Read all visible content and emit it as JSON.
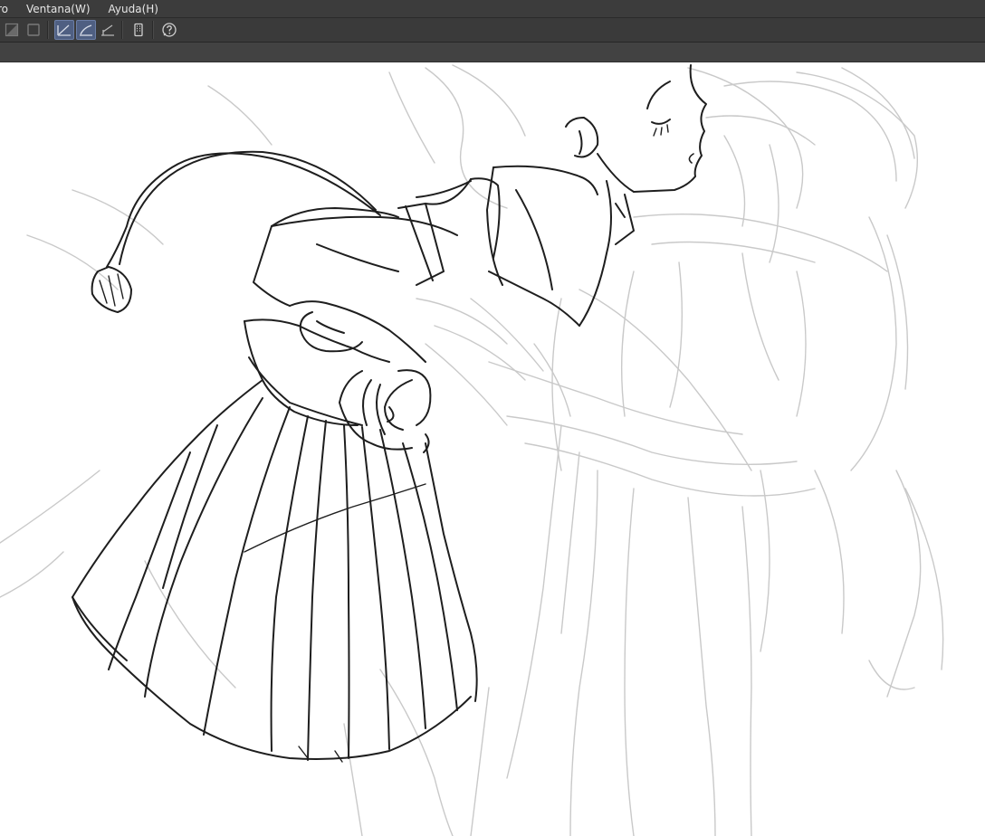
{
  "menubar": {
    "items": [
      {
        "label": "ro"
      },
      {
        "label": "Ventana(W)"
      },
      {
        "label": "Ayuda(H)"
      }
    ]
  },
  "toolbar": {
    "buttons": [
      {
        "icon": "layer-fill-icon",
        "active": false
      },
      {
        "icon": "layer-frame-icon",
        "active": false
      },
      {
        "icon": "ruler-snap-icon",
        "active": true
      },
      {
        "icon": "special-ruler-snap-icon",
        "active": true
      },
      {
        "icon": "grid-snap-icon",
        "active": false
      },
      {
        "icon": "device-icon",
        "active": false
      },
      {
        "icon": "help-icon",
        "active": false
      }
    ]
  },
  "colors": {
    "menubar_bg": "#3c3c3c",
    "toolbar_bg": "#3a3a3a",
    "active_button": "#4f5f82",
    "canvas_bg": "#ffffff",
    "ink": "#1e1e1e",
    "sketch": "#c8c8c8"
  }
}
